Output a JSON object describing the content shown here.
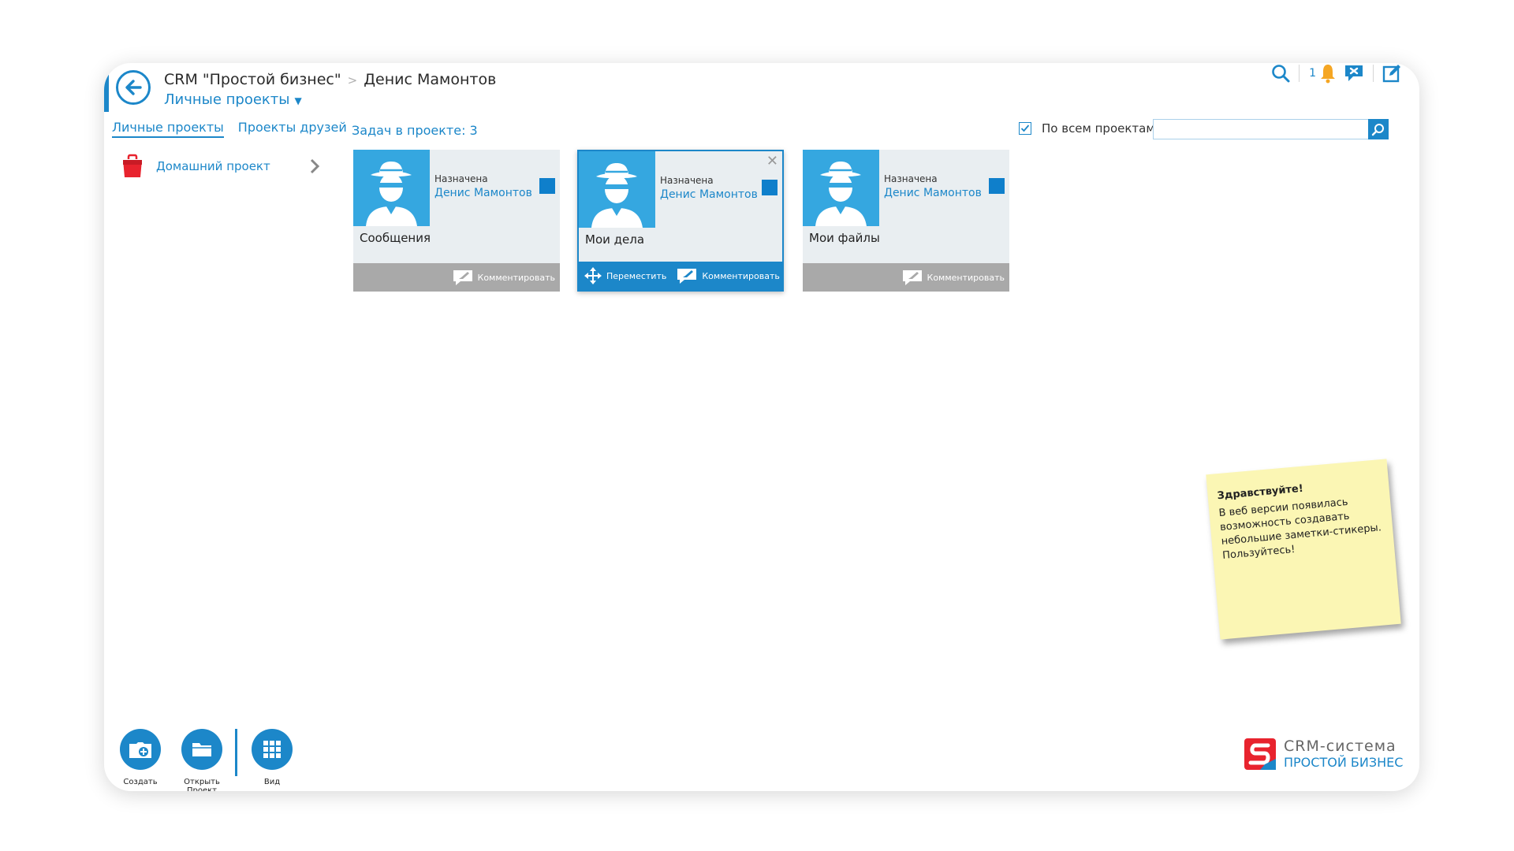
{
  "header": {
    "breadcrumb_root": "CRM \"Простой бизнес\"",
    "breadcrumb_user": "Денис Мамонтов",
    "section_title": "Личные проекты",
    "notification_count": "1"
  },
  "tabs": [
    {
      "label": "Личные проекты",
      "active": true
    },
    {
      "label": "Проекты друзей",
      "active": false
    }
  ],
  "projects": [
    {
      "label": "Домашний проект"
    }
  ],
  "main": {
    "task_count_label": "Задач в проекте: 3",
    "all_projects_label": "По всем проектам",
    "all_projects_checked": true,
    "search_value": ""
  },
  "cards": [
    {
      "title": "Сообщения",
      "assigned_label": "Назначена",
      "assignee": "Денис Мамонтов",
      "comment_label": "Комментировать"
    },
    {
      "title": "Мои дела",
      "assigned_label": "Назначена",
      "assignee": "Денис Мамонтов",
      "move_label": "Переместить",
      "comment_label": "Комментировать",
      "selected": true
    },
    {
      "title": "Мои файлы",
      "assigned_label": "Назначена",
      "assignee": "Денис Мамонтов",
      "comment_label": "Комментировать"
    }
  ],
  "sticky_note": {
    "title": "Здравствуйте!",
    "body": "В веб версии появилась возможность создавать небольшие заметки-стикеры. Пользуйтесь!"
  },
  "toolbar": {
    "create_label": "Создать",
    "open_label": "Открыть Проект",
    "view_label": "Вид"
  },
  "brand": {
    "line1": "CRM-система",
    "line2": "ПРОСТОЙ БИЗНЕС"
  },
  "colors": {
    "accent": "#1c87c9",
    "avatar_bg": "#35a7e0",
    "sticky_bg": "#fbf6b4",
    "bell": "#f5a623",
    "project_icon": "#e8232e"
  },
  "icons": {
    "back": "arrow-left-circle-icon",
    "search": "magnifier-icon",
    "notifications": "bell-icon",
    "messages": "chat-icon",
    "edit": "edit-icon",
    "project": "briefcase-icon",
    "avatar": "spy-avatar-icon"
  }
}
